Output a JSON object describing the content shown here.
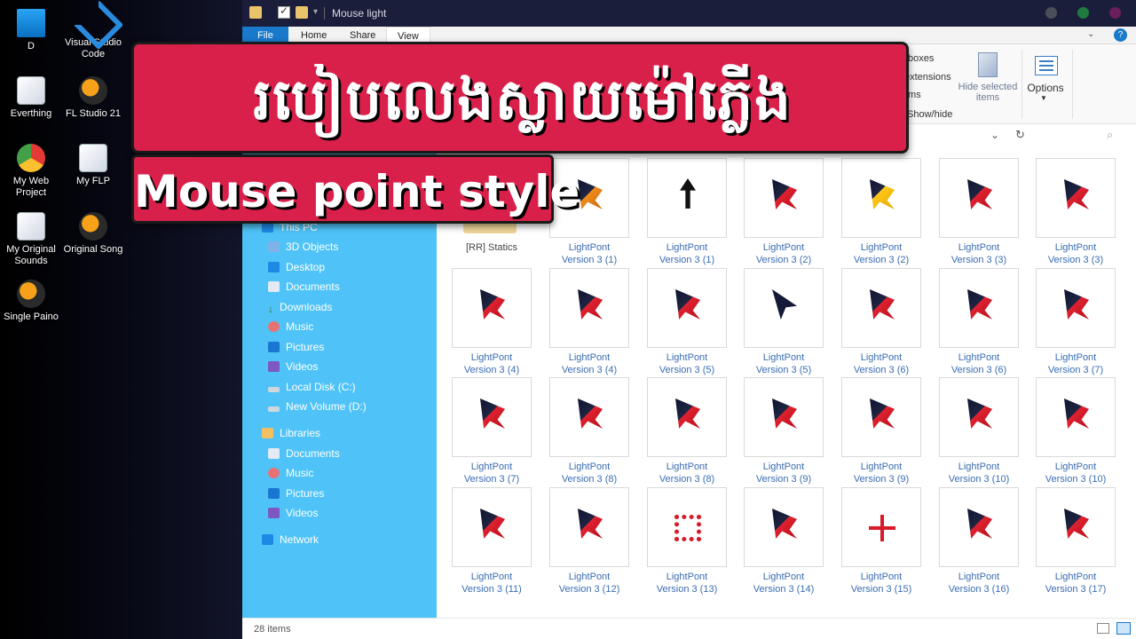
{
  "desktop": {
    "icons": [
      {
        "label": "D",
        "icon": "monitor-icon"
      },
      {
        "label": "Visual Studio Code",
        "icon": "vscode-icon"
      },
      {
        "label": "Everthing",
        "icon": "file-shortcut-icon"
      },
      {
        "label": "FL Studio 21",
        "icon": "fl-studio-icon"
      },
      {
        "label": "My Web Project",
        "icon": "chrome-icon"
      },
      {
        "label": "My FLP",
        "icon": "file-shortcut-icon"
      },
      {
        "label": "My Original Sounds",
        "icon": "file-shortcut-icon"
      },
      {
        "label": "Original Song",
        "icon": "fl-studio-icon"
      },
      {
        "label": "Single Paino",
        "icon": "fl-studio-icon"
      }
    ]
  },
  "window": {
    "title": "Mouse light"
  },
  "ribbon": {
    "tabs": [
      "File",
      "Home",
      "Share",
      "View"
    ],
    "active_tab": "View",
    "partial_items": [
      "boxes",
      "extensions",
      "ms",
      "Show/hide"
    ],
    "hide_selected_label": "Hide selected items",
    "options_label": "Options"
  },
  "nav": {
    "items": [
      {
        "label": "This PC",
        "icon": "pc-icon"
      },
      {
        "label": "3D Objects",
        "icon": "3d-objects-icon"
      },
      {
        "label": "Desktop",
        "icon": "desktop-icon"
      },
      {
        "label": "Documents",
        "icon": "documents-icon"
      },
      {
        "label": "Downloads",
        "icon": "downloads-icon"
      },
      {
        "label": "Music",
        "icon": "music-icon"
      },
      {
        "label": "Pictures",
        "icon": "pictures-icon"
      },
      {
        "label": "Videos",
        "icon": "videos-icon"
      },
      {
        "label": "Local Disk (C:)",
        "icon": "disk-icon"
      },
      {
        "label": "New Volume (D:)",
        "icon": "disk-icon"
      },
      {
        "label": "Libraries",
        "icon": "folder-icon"
      },
      {
        "label": "Documents",
        "icon": "documents-icon"
      },
      {
        "label": "Music",
        "icon": "music-icon"
      },
      {
        "label": "Pictures",
        "icon": "pictures-icon"
      },
      {
        "label": "Videos",
        "icon": "videos-icon"
      },
      {
        "label": "Network",
        "icon": "network-icon"
      }
    ]
  },
  "files": [
    {
      "name": "[RR] Statics",
      "sub": "",
      "icon": "folder-icon",
      "accent": "#e9c46a"
    },
    {
      "name": "LightPont",
      "sub": "Version 3 (1)",
      "icon": "cursor-icon",
      "accent": "#f08a1c"
    },
    {
      "name": "LightPont",
      "sub": "Version 3 (1)",
      "icon": "arrow-up-cursor-icon",
      "accent": "#111111"
    },
    {
      "name": "LightPont",
      "sub": "Version 3 (2)",
      "icon": "cursor-icon",
      "accent": "#e0212f"
    },
    {
      "name": "LightPont",
      "sub": "Version 3 (2)",
      "icon": "cursor-icon",
      "accent": "#ffc61a"
    },
    {
      "name": "LightPont",
      "sub": "Version 3 (3)",
      "icon": "cursor-icon",
      "accent": "#e0212f"
    },
    {
      "name": "LightPont",
      "sub": "Version 3 (3)",
      "icon": "cursor-icon",
      "accent": "#e0212f"
    },
    {
      "name": "LightPont",
      "sub": "Version 3 (4)",
      "icon": "cursor-icon",
      "accent": "#e0212f"
    },
    {
      "name": "LightPont",
      "sub": "Version 3 (4)",
      "icon": "cursor-icon",
      "accent": "#e0212f"
    },
    {
      "name": "LightPont",
      "sub": "Version 3 (5)",
      "icon": "cursor-icon",
      "accent": "#e0212f"
    },
    {
      "name": "LightPont",
      "sub": "Version 3 (5)",
      "icon": "arrow-cursor-icon",
      "accent": "#141a38"
    },
    {
      "name": "LightPont",
      "sub": "Version 3 (6)",
      "icon": "cursor-icon",
      "accent": "#e0212f"
    },
    {
      "name": "LightPont",
      "sub": "Version 3 (6)",
      "icon": "help-cursor-icon",
      "accent": "#e0212f"
    },
    {
      "name": "LightPont",
      "sub": "Version 3 (7)",
      "icon": "cursor-icon",
      "accent": "#e0212f"
    },
    {
      "name": "LightPont",
      "sub": "Version 3 (7)",
      "icon": "cursor-icon",
      "accent": "#e0212f"
    },
    {
      "name": "LightPont",
      "sub": "Version 3 (8)",
      "icon": "cursor-icon",
      "accent": "#e0212f"
    },
    {
      "name": "LightPont",
      "sub": "Version 3 (8)",
      "icon": "cursor-icon",
      "accent": "#e0212f"
    },
    {
      "name": "LightPont",
      "sub": "Version 3 (9)",
      "icon": "cursor-icon",
      "accent": "#e0212f"
    },
    {
      "name": "LightPont",
      "sub": "Version 3 (9)",
      "icon": "cursor-icon",
      "accent": "#e0212f"
    },
    {
      "name": "LightPont",
      "sub": "Version 3 (10)",
      "icon": "cursor-icon",
      "accent": "#e0212f"
    },
    {
      "name": "LightPont",
      "sub": "Version 3 (10)",
      "icon": "cursor-icon",
      "accent": "#e0212f"
    },
    {
      "name": "LightPont",
      "sub": "Version 3 (11)",
      "icon": "cursor-icon",
      "accent": "#e0212f"
    },
    {
      "name": "LightPont",
      "sub": "Version 3 (12)",
      "icon": "cursor-icon",
      "accent": "#e0212f"
    },
    {
      "name": "LightPont",
      "sub": "Version 3 (13)",
      "icon": "target-cursor-icon",
      "accent": "#d81b2a"
    },
    {
      "name": "LightPont",
      "sub": "Version 3 (14)",
      "icon": "cursor-icon",
      "accent": "#e0212f"
    },
    {
      "name": "LightPont",
      "sub": "Version 3 (15)",
      "icon": "cross-cursor-icon",
      "accent": "#d81b2a"
    },
    {
      "name": "LightPont",
      "sub": "Version 3 (16)",
      "icon": "cursor-icon",
      "accent": "#e0212f"
    },
    {
      "name": "LightPont",
      "sub": "Version 3 (17)",
      "icon": "cursor-icon",
      "accent": "#e0212f"
    }
  ],
  "status": {
    "item_count": "28 items"
  },
  "overlay": {
    "khmer_title": "របៀបលេងស្លាយម៉ៅភ្លើង",
    "english_title": "Mouse point style"
  }
}
